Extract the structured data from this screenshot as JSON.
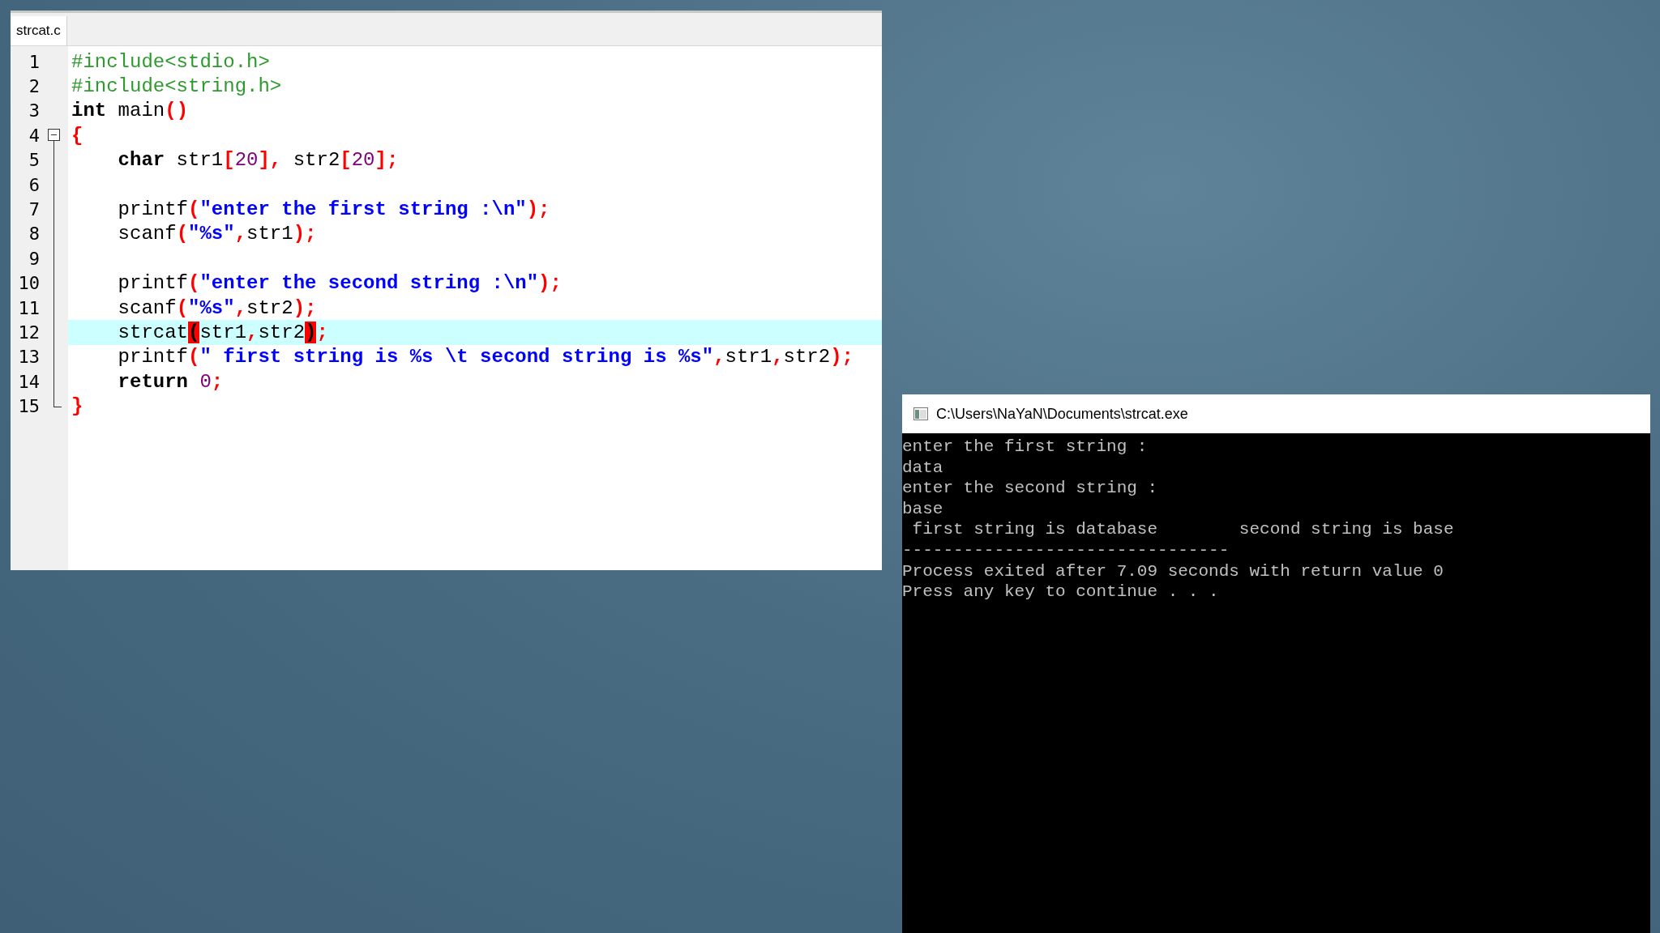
{
  "editor": {
    "tab": {
      "label": "strcat.c",
      "selected": true
    },
    "lines": [
      {
        "number": "1",
        "current": false,
        "tokens": [
          {
            "kind": "preprocessor",
            "text": "#include<stdio.h>"
          }
        ]
      },
      {
        "number": "2",
        "current": false,
        "tokens": [
          {
            "kind": "preprocessor",
            "text": "#include<string.h>"
          }
        ]
      },
      {
        "number": "3",
        "current": false,
        "tokens": [
          {
            "kind": "keyword",
            "text": "int"
          },
          {
            "kind": "plain",
            "text": " main"
          },
          {
            "kind": "symbol",
            "text": "()"
          }
        ]
      },
      {
        "number": "4",
        "current": false,
        "expanded": true,
        "tokens": [
          {
            "kind": "symbol",
            "text": "{"
          }
        ]
      },
      {
        "number": "5",
        "current": false,
        "tokens": [
          {
            "kind": "keyword",
            "text": "    char"
          },
          {
            "kind": "plain",
            "text": " str1"
          },
          {
            "kind": "symbol",
            "text": "["
          },
          {
            "kind": "number",
            "text": "20"
          },
          {
            "kind": "symbol",
            "text": "], "
          },
          {
            "kind": "plain",
            "text": "str2"
          },
          {
            "kind": "symbol",
            "text": "["
          },
          {
            "kind": "number",
            "text": "20"
          },
          {
            "kind": "symbol",
            "text": "];"
          }
        ]
      },
      {
        "number": "6",
        "current": false
      },
      {
        "number": "7",
        "current": false,
        "tokens": [
          {
            "kind": "plain",
            "text": "    printf"
          },
          {
            "kind": "symbol",
            "text": "("
          },
          {
            "kind": "string",
            "text": "\"enter the first string :\\n\""
          },
          {
            "kind": "symbol",
            "text": ");"
          }
        ]
      },
      {
        "number": "8",
        "current": false,
        "tokens": [
          {
            "kind": "plain",
            "text": "    scanf"
          },
          {
            "kind": "symbol",
            "text": "("
          },
          {
            "kind": "string",
            "text": "\"%s\""
          },
          {
            "kind": "symbol",
            "text": ","
          },
          {
            "kind": "plain",
            "text": "str1"
          },
          {
            "kind": "symbol",
            "text": ");"
          }
        ]
      },
      {
        "number": "9",
        "current": false
      },
      {
        "number": "10",
        "current": false,
        "tokens": [
          {
            "kind": "plain",
            "text": "    printf"
          },
          {
            "kind": "symbol",
            "text": "("
          },
          {
            "kind": "string",
            "text": "\"enter the second string :\\n\""
          },
          {
            "kind": "symbol",
            "text": ");"
          }
        ]
      },
      {
        "number": "11",
        "current": false,
        "tokens": [
          {
            "kind": "plain",
            "text": "    scanf"
          },
          {
            "kind": "symbol",
            "text": "("
          },
          {
            "kind": "string",
            "text": "\"%s\""
          },
          {
            "kind": "symbol",
            "text": ","
          },
          {
            "kind": "plain",
            "text": "str2"
          },
          {
            "kind": "symbol",
            "text": ");"
          }
        ]
      },
      {
        "number": "12",
        "current": true,
        "tokens": [
          {
            "kind": "plain",
            "text": "    strcat"
          },
          {
            "kind": "match",
            "text": "("
          },
          {
            "kind": "plain",
            "text": "str1"
          },
          {
            "kind": "symbol",
            "text": ","
          },
          {
            "kind": "plain",
            "text": "str2"
          },
          {
            "kind": "match",
            "text": ")"
          },
          {
            "kind": "symbol",
            "text": ";"
          }
        ]
      },
      {
        "number": "13",
        "current": false,
        "tokens": [
          {
            "kind": "plain",
            "text": "    printf"
          },
          {
            "kind": "symbol",
            "text": "("
          },
          {
            "kind": "string",
            "text": "\" first string is %s \\t second string is %s\""
          },
          {
            "kind": "symbol",
            "text": ","
          },
          {
            "kind": "plain",
            "text": "str1"
          },
          {
            "kind": "symbol",
            "text": ","
          },
          {
            "kind": "plain",
            "text": "str2"
          },
          {
            "kind": "symbol",
            "text": ");"
          }
        ]
      },
      {
        "number": "14",
        "current": false,
        "tokens": [
          {
            "kind": "keyword",
            "text": "    return"
          },
          {
            "kind": "number",
            "text": " 0"
          },
          {
            "kind": "symbol",
            "text": ";"
          }
        ]
      },
      {
        "number": "15",
        "current": false,
        "block_end": true,
        "tokens": [
          {
            "kind": "symbol",
            "text": "}"
          }
        ]
      }
    ]
  },
  "console": {
    "title": "C:\\Users\\NaYaN\\Documents\\strcat.exe",
    "output": [
      "enter the first string :",
      "data",
      "enter the second string :",
      "base",
      " first string is database        second string is base",
      "--------------------------------",
      "Process exited after 7.09 seconds with return value 0",
      "Press any key to continue . . ."
    ]
  }
}
